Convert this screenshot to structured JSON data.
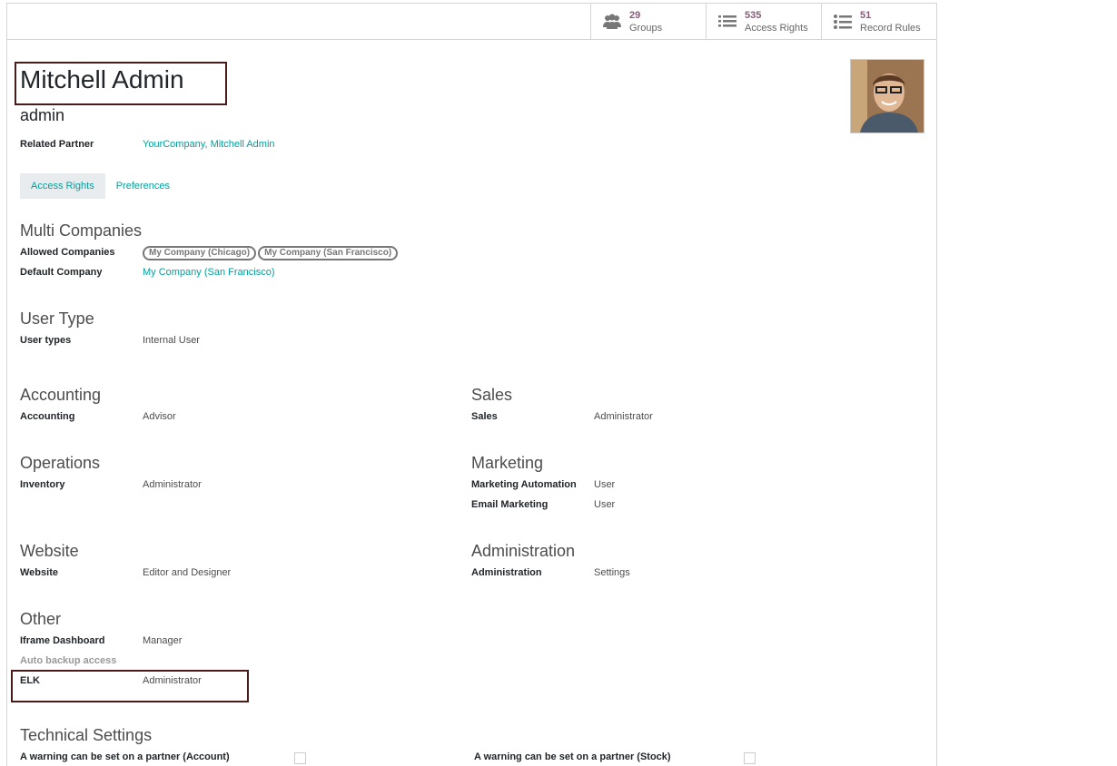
{
  "stats": [
    {
      "value": "29",
      "label": "Groups",
      "icon": "users-icon"
    },
    {
      "value": "535",
      "label": "Access Rights",
      "icon": "list-icon"
    },
    {
      "value": "51",
      "label": "Record Rules",
      "icon": "bullet-list-icon"
    }
  ],
  "user": {
    "name": "Mitchell Admin",
    "login": "admin"
  },
  "related_partner": {
    "label": "Related Partner",
    "value": "YourCompany, Mitchell Admin"
  },
  "tabs": [
    "Access Rights",
    "Preferences"
  ],
  "multi_companies": {
    "title": "Multi Companies",
    "allowed_label": "Allowed Companies",
    "allowed": [
      "My Company (Chicago)",
      "My Company (San Francisco)"
    ],
    "default_label": "Default Company",
    "default_value": "My Company (San Francisco)"
  },
  "user_type": {
    "title": "User Type",
    "label": "User types",
    "value": "Internal User"
  },
  "accounting": {
    "title": "Accounting",
    "label": "Accounting",
    "value": "Advisor"
  },
  "sales": {
    "title": "Sales",
    "label": "Sales",
    "value": "Administrator"
  },
  "operations": {
    "title": "Operations",
    "label": "Inventory",
    "value": "Administrator"
  },
  "marketing": {
    "title": "Marketing",
    "rows": [
      {
        "label": "Marketing Automation",
        "value": "User"
      },
      {
        "label": "Email Marketing",
        "value": "User"
      }
    ]
  },
  "website": {
    "title": "Website",
    "label": "Website",
    "value": "Editor and Designer"
  },
  "administration": {
    "title": "Administration",
    "label": "Administration",
    "value": "Settings"
  },
  "other": {
    "title": "Other",
    "rows": [
      {
        "label": "Iframe Dashboard",
        "value": "Manager"
      },
      {
        "label": "Auto backup access",
        "value": ""
      },
      {
        "label": "ELK",
        "value": "Administrator"
      }
    ]
  },
  "technical": {
    "title": "Technical Settings",
    "left_label": "A warning can be set on a partner (Account)",
    "right_label": "A warning can be set on a partner (Stock)"
  },
  "colors": {
    "accent": "#875a7b",
    "link": "#00a09d",
    "highlight_border": "#4a1b1b"
  }
}
